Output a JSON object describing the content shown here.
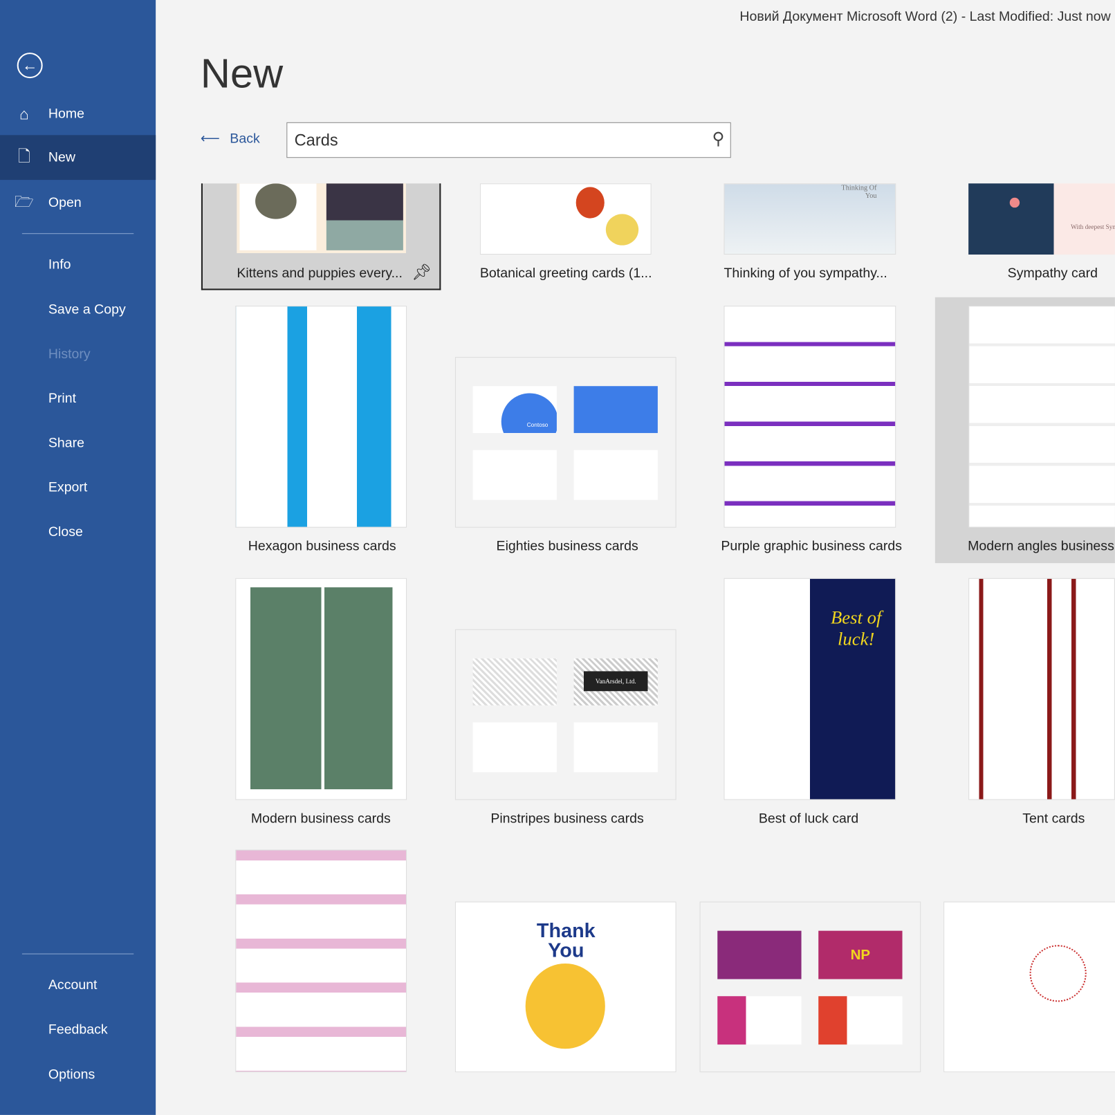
{
  "window_title": "Новий Документ Microsoft Word (2)  -  Last Modified: Just now",
  "sidebar": {
    "back_icon": "arrow-left-circle-icon",
    "items": [
      {
        "label": "Home",
        "icon": "home-icon"
      },
      {
        "label": "New",
        "icon": "new-document-icon",
        "selected": true
      },
      {
        "label": "Open",
        "icon": "folder-icon"
      },
      {
        "label": "Info"
      },
      {
        "label": "Save a Copy"
      },
      {
        "label": "History",
        "disabled": true
      },
      {
        "label": "Print"
      },
      {
        "label": "Share"
      },
      {
        "label": "Export"
      },
      {
        "label": "Close"
      },
      {
        "label": "Account"
      },
      {
        "label": "Feedback"
      },
      {
        "label": "Options"
      }
    ]
  },
  "main": {
    "heading": "New",
    "back_label": "Back",
    "search": {
      "value": "Cards",
      "icon": "search-icon"
    },
    "templates": [
      {
        "label": "Kittens and puppies every...",
        "selected": true,
        "pin_icon": "pin-icon"
      },
      {
        "label": "Botanical greeting cards (1..."
      },
      {
        "label": "Thinking of you sympathy..."
      },
      {
        "label": "Sympathy card"
      },
      {
        "label": "Hexagon business cards"
      },
      {
        "label": "Eighties business cards"
      },
      {
        "label": "Purple graphic business cards"
      },
      {
        "label": "Modern angles business cards",
        "hovered": true
      },
      {
        "label": "Modern business cards"
      },
      {
        "label": "Pinstripes business cards"
      },
      {
        "label": "Best of luck card"
      },
      {
        "label": "Tent cards"
      },
      {
        "label": ""
      },
      {
        "label": ""
      },
      {
        "label": ""
      },
      {
        "label": ""
      }
    ],
    "thumb_text": {
      "thank_you": "Thank You",
      "best_of_luck": "Best of luck!",
      "vanarsdel": "VanArsdel, Ltd.",
      "contoso": "Contoso",
      "np": "NP",
      "thinking": "Thinking Of You",
      "sympathy": "With deepest Sympathy"
    }
  },
  "colors": {
    "sidebar": "#2b579a",
    "selected": "#1f3f73",
    "background": "#f3f3f3"
  }
}
